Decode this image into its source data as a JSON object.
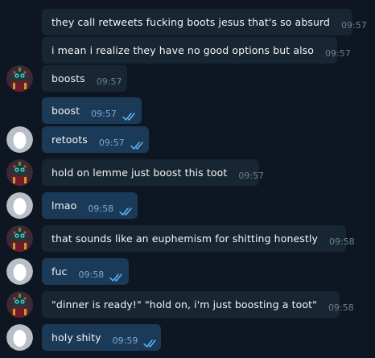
{
  "messages": [
    {
      "id": "m1",
      "text": "they call retweets fucking boots jesus that's so absurd",
      "time": "09:57",
      "direction": "in",
      "sender": "",
      "read": false
    },
    {
      "id": "m2",
      "text": "i mean i realize they have no good options but also",
      "time": "09:57",
      "direction": "in",
      "sender": "",
      "read": false
    },
    {
      "id": "m3",
      "text": "boosts",
      "time": "09:57",
      "direction": "in",
      "sender": "",
      "read": false
    },
    {
      "id": "m4",
      "text": "boost",
      "time": "09:57",
      "direction": "out",
      "read": true
    },
    {
      "id": "m5",
      "text": "retoots",
      "time": "09:57",
      "direction": "out",
      "read": true
    },
    {
      "id": "m6",
      "text": "hold on lemme just boost this toot",
      "time": "09:57",
      "direction": "in",
      "read": false
    },
    {
      "id": "m7",
      "text": "lmao",
      "time": "09:58",
      "direction": "out",
      "read": true
    },
    {
      "id": "m8",
      "text": "that sounds like an euphemism for shitting honestly",
      "time": "09:58",
      "direction": "in",
      "read": false
    },
    {
      "id": "m9",
      "text": "fuc",
      "time": "09:58",
      "direction": "out",
      "read": true
    },
    {
      "id": "m10",
      "text": "\"dinner is ready!\" \"hold on, i'm just boosting a toot\"",
      "time": "09:58",
      "direction": "in",
      "read": false
    },
    {
      "id": "m11",
      "text": "holy shity",
      "time": "09:59",
      "direction": "out",
      "read": true
    }
  ],
  "icons": {
    "incoming_avatar": "robot-avatar-icon",
    "outgoing_avatar": "egg-avatar-icon",
    "read_receipt": "double-check-icon"
  },
  "colors": {
    "background": "#0e1621",
    "incoming_bubble": "#182533",
    "outgoing_bubble": "#1b3a58",
    "text": "#f5f5f5",
    "time_incoming": "#6d7f8f",
    "time_outgoing": "#7da8d3",
    "check": "#5eb5f7"
  }
}
